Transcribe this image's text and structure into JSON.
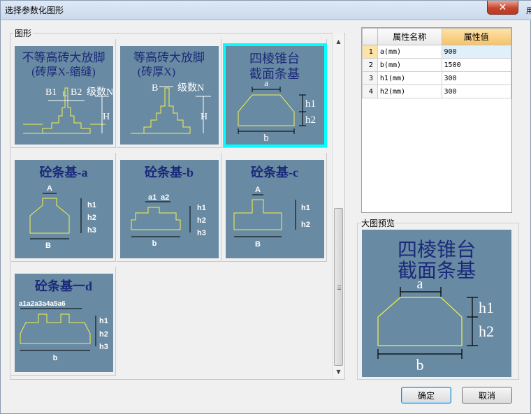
{
  "window": {
    "title": "选择参数化图形",
    "close_symbol": "✕",
    "edge_fragment": "用"
  },
  "shapes_group": {
    "label": "图形"
  },
  "shapes": [
    {
      "title_lines": [
        "不等高砖大放脚",
        "(砖厚X-缩缝)"
      ],
      "labels": [
        "B1",
        "L",
        "B2",
        "级数N",
        "H"
      ],
      "selected": false
    },
    {
      "title_lines": [
        "等高砖大放脚",
        "(砖厚X)"
      ],
      "labels": [
        "B",
        "级数N",
        "H"
      ],
      "selected": false
    },
    {
      "title_lines": [
        "四棱锥台",
        "截面条基"
      ],
      "labels": [
        "a",
        "h1",
        "h2",
        "b"
      ],
      "selected": true
    },
    {
      "title_lines": [
        "砼条基-a"
      ],
      "labels": [
        "A",
        "h1",
        "h2",
        "h3",
        "B"
      ],
      "selected": false
    },
    {
      "title_lines": [
        "砼条基-b"
      ],
      "labels": [
        "a1",
        "a2",
        "h1",
        "h2",
        "h3",
        "b"
      ],
      "selected": false
    },
    {
      "title_lines": [
        "砼条基-c"
      ],
      "labels": [
        "A",
        "h1",
        "h2",
        "B"
      ],
      "selected": false
    },
    {
      "title_lines": [
        "砼条基一d"
      ],
      "labels": [
        "a1a2a3a4a5a6",
        "h1",
        "h2",
        "h3",
        "b"
      ],
      "selected": false
    }
  ],
  "property_grid": {
    "headers": {
      "name": "属性名称",
      "value": "属性值"
    },
    "rows": [
      {
        "num": "1",
        "name": "a(mm)",
        "value": "900",
        "active": true
      },
      {
        "num": "2",
        "name": "b(mm)",
        "value": "1500",
        "active": false
      },
      {
        "num": "3",
        "name": "h1(mm)",
        "value": "300",
        "active": false
      },
      {
        "num": "4",
        "name": "h2(mm)",
        "value": "300",
        "active": false
      }
    ]
  },
  "preview": {
    "label": "大图预览",
    "title_lines": [
      "四棱锥台",
      "截面条基"
    ],
    "labels": [
      "a",
      "h1",
      "h2",
      "b"
    ]
  },
  "buttons": {
    "ok": "确定",
    "cancel": "取消"
  },
  "colors": {
    "thumb_bg": "#698aa3",
    "title_text": "#1a2a7a",
    "shape_line": "#f2f24a",
    "label_text": "#ffffff",
    "selected_border": "#00ffff"
  }
}
